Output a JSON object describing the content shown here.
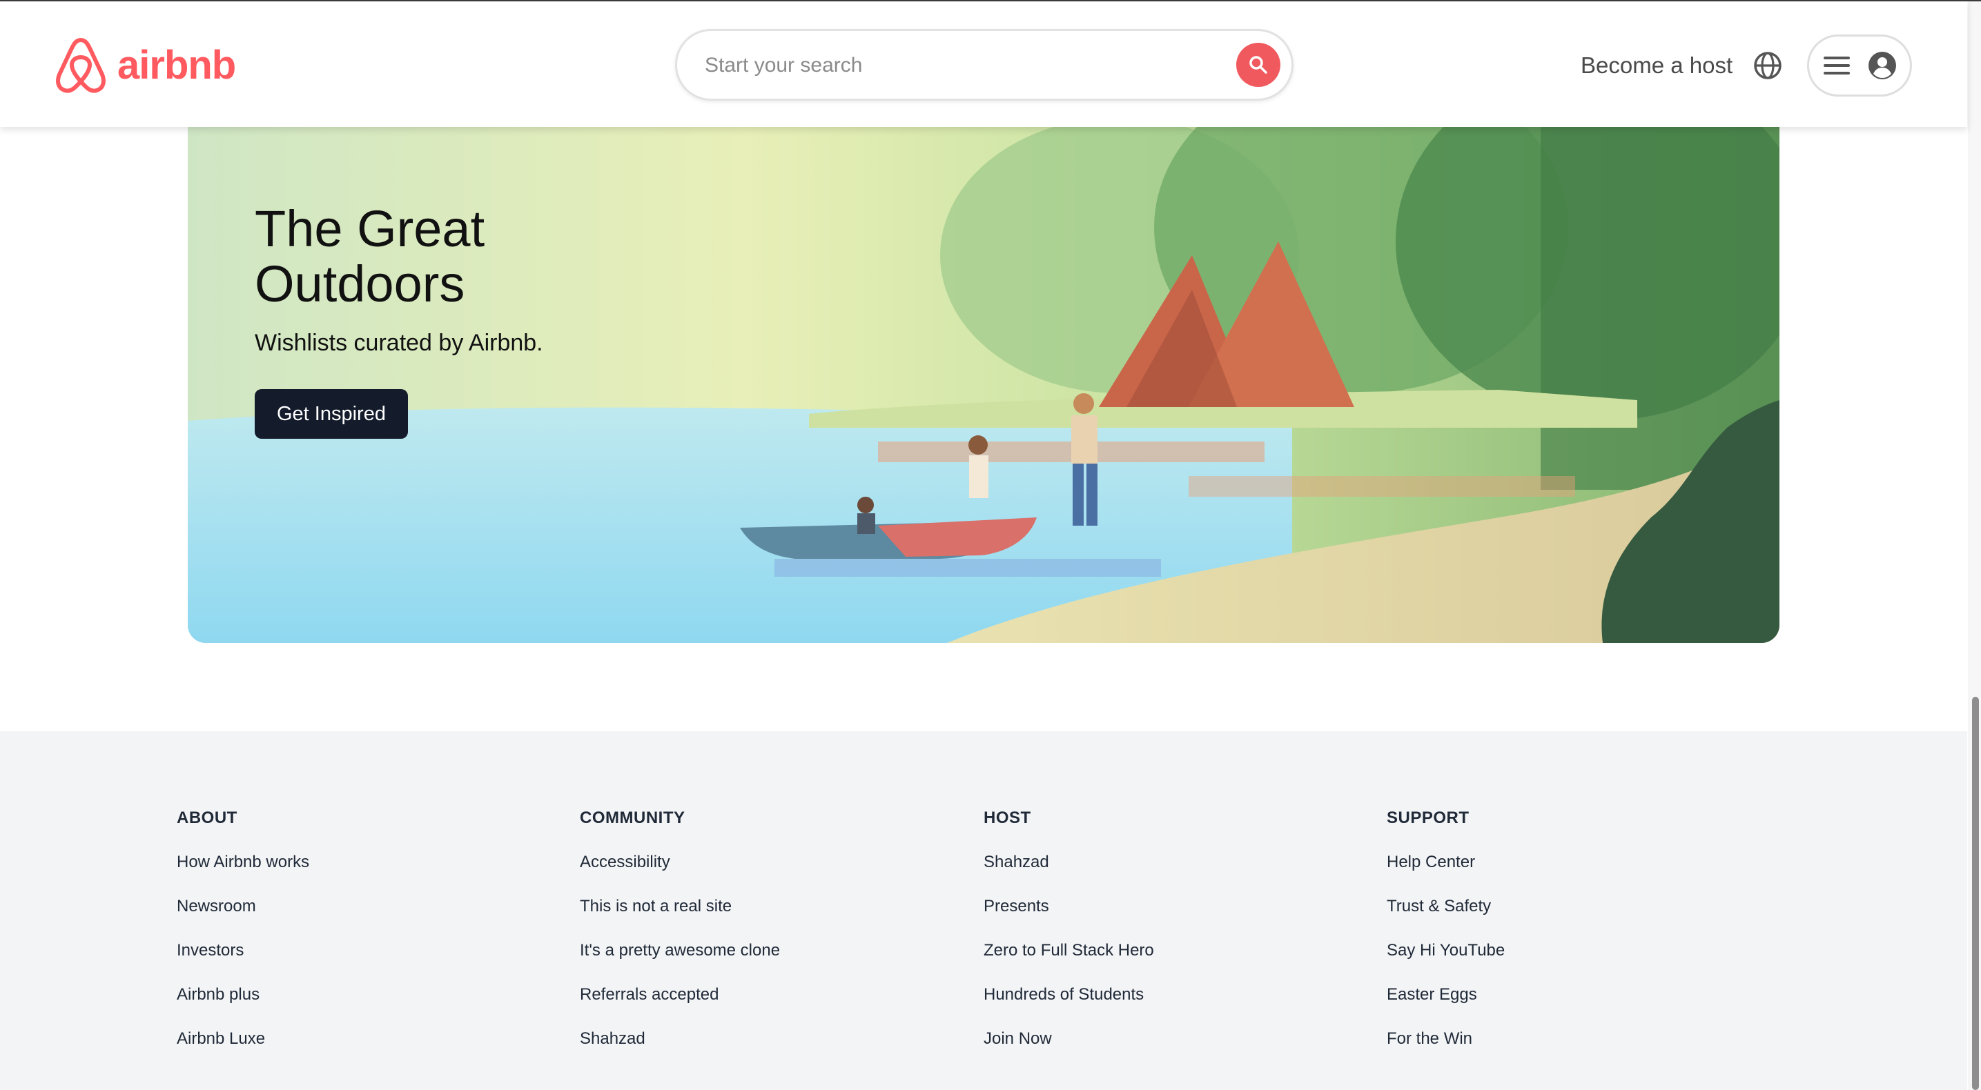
{
  "header": {
    "logo_text": "airbnb",
    "search_placeholder": "Start your search",
    "host_link": "Become a host",
    "icons": {
      "logo": "airbnb-belo-icon",
      "search": "search-icon",
      "globe": "globe-icon",
      "menu": "hamburger-menu-icon",
      "profile": "user-avatar-icon"
    }
  },
  "banner": {
    "title": "The Great Outdoors",
    "subtitle": "Wishlists curated by Airbnb.",
    "button_label": "Get Inspired"
  },
  "footer": {
    "columns": [
      {
        "heading": "ABOUT",
        "links": [
          "How Airbnb works",
          "Newsroom",
          "Investors",
          "Airbnb plus",
          "Airbnb Luxe"
        ]
      },
      {
        "heading": "COMMUNITY",
        "links": [
          "Accessibility",
          "This is not a real site",
          "It's a pretty awesome clone",
          "Referrals accepted",
          "Shahzad"
        ]
      },
      {
        "heading": "HOST",
        "links": [
          "Shahzad",
          "Presents",
          "Zero to Full Stack Hero",
          "Hundreds of Students",
          "Join Now"
        ]
      },
      {
        "heading": "SUPPORT",
        "links": [
          "Help Center",
          "Trust & Safety",
          "Say Hi YouTube",
          "Easter Eggs",
          "For the Win"
        ]
      }
    ]
  },
  "colors": {
    "brand": "#FF5A5F",
    "button_dark": "#141c2c",
    "footer_bg": "#f3f4f6"
  }
}
